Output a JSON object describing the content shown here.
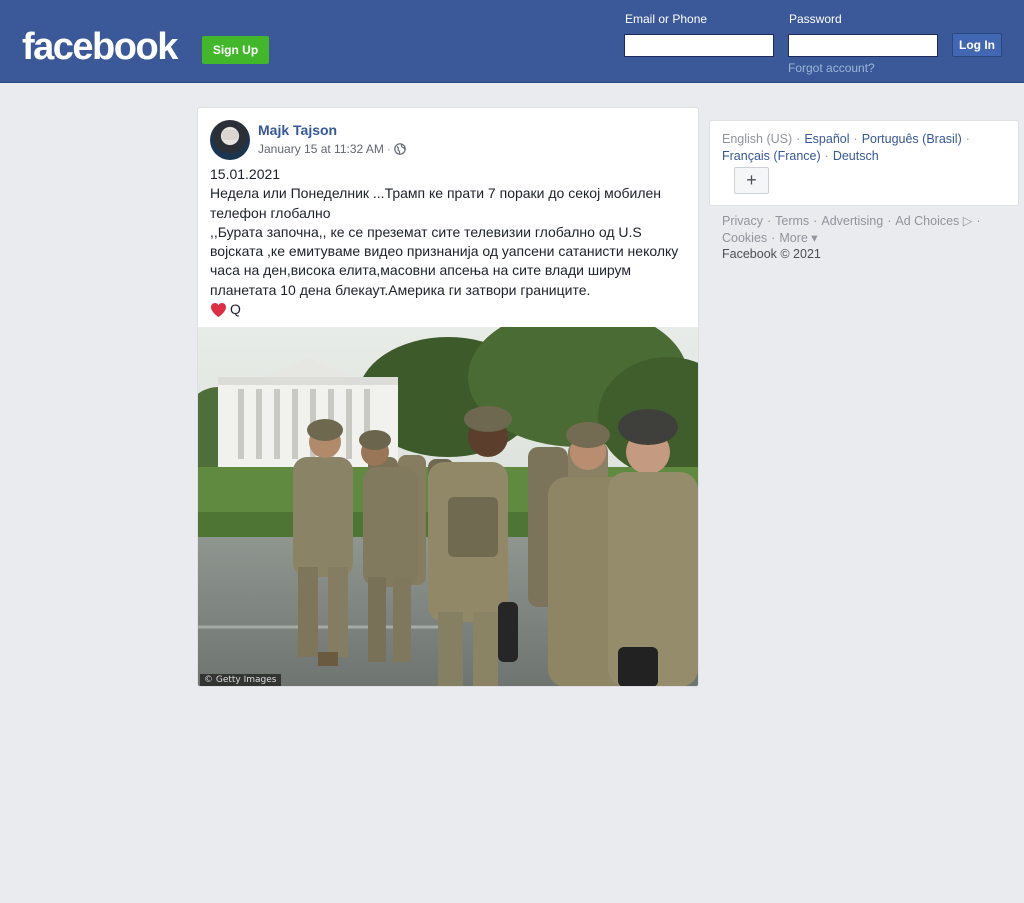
{
  "header": {
    "logo": "facebook",
    "signup_label": "Sign Up",
    "email_label": "Email or Phone",
    "email_value": "",
    "password_label": "Password",
    "password_value": "",
    "login_label": "Log In",
    "forgot_label": "Forgot account?"
  },
  "post": {
    "author": "Majk Tajson",
    "timestamp": "January 15 at 11:32 AM",
    "separator": "·",
    "privacy_icon": "globe-icon",
    "lines": [
      "15.01.2021",
      "Недела или Понеделник ...Трамп ке прати 7 пораки до секој мобилен телефон глобално",
      ",,Бурата започна,, ке се преземат сите телевизии глобално од U.S војската ,ке емитуваме видео признанија од уапсени сатанисти неколку часа на ден,висока елита,масовни апсења на сите влади ширум планетата 10 дена блекаут.Америка ги затвори границите."
    ],
    "heart_suffix": "Q",
    "image_credit": "© Getty Images"
  },
  "sidebar": {
    "languages": [
      {
        "label": "English (US)",
        "current": true
      },
      {
        "label": "Español",
        "current": false
      },
      {
        "label": "Português (Brasil)",
        "current": false
      },
      {
        "label": "Français (France)",
        "current": false
      },
      {
        "label": "Deutsch",
        "current": false
      }
    ],
    "add_language_label": "+",
    "footer_links": [
      "Privacy",
      "Terms",
      "Advertising",
      "Ad Choices ▷",
      "Cookies",
      "More ▾"
    ],
    "copyright": "Facebook © 2021"
  },
  "colors": {
    "brand": "#3b5998",
    "signup_green": "#42b72a",
    "link": "#365899",
    "background": "#e9ebee"
  }
}
